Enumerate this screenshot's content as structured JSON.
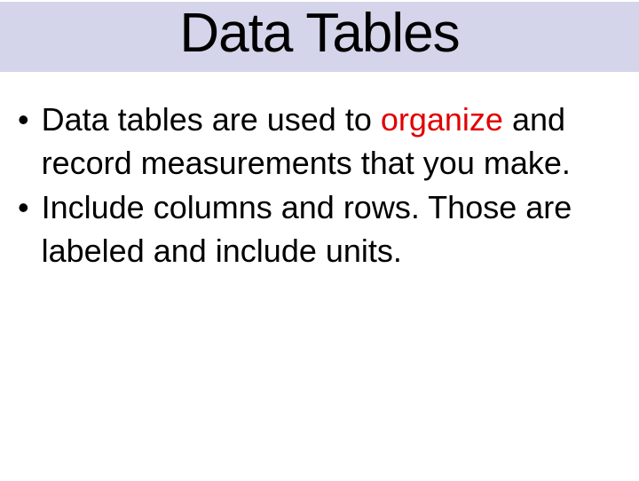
{
  "title": "Data Tables",
  "bullets": [
    {
      "pre": "Data tables are used to ",
      "highlight": "organize",
      "post": " and record measurements that you make."
    },
    {
      "pre": "Include columns and rows. Those are labeled and include units.",
      "highlight": "",
      "post": ""
    }
  ]
}
